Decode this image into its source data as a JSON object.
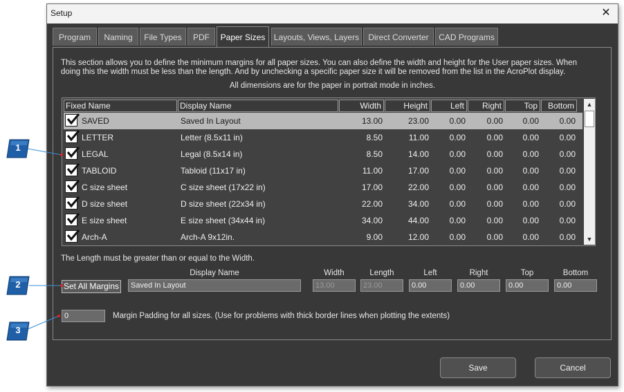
{
  "window": {
    "title": "Setup",
    "close_glyph": "✕"
  },
  "tabs": [
    {
      "label": "Program"
    },
    {
      "label": "Naming"
    },
    {
      "label": "File Types"
    },
    {
      "label": "PDF"
    },
    {
      "label": "Paper Sizes",
      "active": true
    },
    {
      "label": "Layouts, Views, Layers"
    },
    {
      "label": "Direct Converter"
    },
    {
      "label": "CAD Programs"
    }
  ],
  "info": {
    "line1": "This section allows you to define the minimum margins for all paper sizes.  You can also define the width and height for the User paper sizes.  When",
    "line2": "doing this the width must be less than the length.  And by unchecking a specific paper size it will be removed from the list in the AcroPlot display.",
    "line3": "All dimensions are for the paper in portrait mode in inches."
  },
  "grid": {
    "columns": [
      "Fixed Name",
      "Display Name",
      "Width",
      "Height",
      "Left",
      "Right",
      "Top",
      "Bottom"
    ],
    "rows": [
      {
        "checked": true,
        "fixed": "SAVED",
        "display": "Saved In Layout",
        "width": "13.00",
        "height": "23.00",
        "left": "0.00",
        "right": "0.00",
        "top": "0.00",
        "bottom": "0.00",
        "selected": true
      },
      {
        "checked": true,
        "fixed": "LETTER",
        "display": "Letter (8.5x11 in)",
        "width": "8.50",
        "height": "11.00",
        "left": "0.00",
        "right": "0.00",
        "top": "0.00",
        "bottom": "0.00"
      },
      {
        "checked": true,
        "fixed": "LEGAL",
        "display": "Legal (8.5x14 in)",
        "width": "8.50",
        "height": "14.00",
        "left": "0.00",
        "right": "0.00",
        "top": "0.00",
        "bottom": "0.00"
      },
      {
        "checked": true,
        "fixed": "TABLOID",
        "display": "Tabloid (11x17 in)",
        "width": "11.00",
        "height": "17.00",
        "left": "0.00",
        "right": "0.00",
        "top": "0.00",
        "bottom": "0.00"
      },
      {
        "checked": true,
        "fixed": "C size sheet",
        "display": "C size sheet (17x22 in)",
        "width": "17.00",
        "height": "22.00",
        "left": "0.00",
        "right": "0.00",
        "top": "0.00",
        "bottom": "0.00"
      },
      {
        "checked": true,
        "fixed": "D size sheet",
        "display": "D size sheet (22x34 in)",
        "width": "22.00",
        "height": "34.00",
        "left": "0.00",
        "right": "0.00",
        "top": "0.00",
        "bottom": "0.00"
      },
      {
        "checked": true,
        "fixed": "E size sheet",
        "display": "E size sheet (34x44 in)",
        "width": "34.00",
        "height": "44.00",
        "left": "0.00",
        "right": "0.00",
        "top": "0.00",
        "bottom": "0.00"
      },
      {
        "checked": true,
        "fixed": "Arch-A",
        "display": "Arch-A 9x12in.",
        "width": "9.00",
        "height": "12.00",
        "left": "0.00",
        "right": "0.00",
        "top": "0.00",
        "bottom": "0.00"
      }
    ]
  },
  "note": "The Length must be greater than or equal to the Width.",
  "edit": {
    "labels": {
      "display_name": "Display Name",
      "width": "Width",
      "length": "Length",
      "left": "Left",
      "right": "Right",
      "top": "Top",
      "bottom": "Bottom"
    },
    "set_all_label": "Set All Margins",
    "display_name": "Saved In Layout",
    "width": "13.00",
    "length": "23.00",
    "left": "0.00",
    "right": "0.00",
    "top": "0.00",
    "bottom": "0.00"
  },
  "padding": {
    "value": "0",
    "label": "Margin Padding for all sizes.  (Use for problems with thick border lines when plotting the extents)"
  },
  "buttons": {
    "save": "Save",
    "cancel": "Cancel"
  },
  "callouts": [
    "1",
    "2",
    "3"
  ],
  "colors": {
    "callout_blue": "#1f5fa8",
    "callout_line": "#3b8fd9",
    "marker_red": "#e01f1f"
  }
}
